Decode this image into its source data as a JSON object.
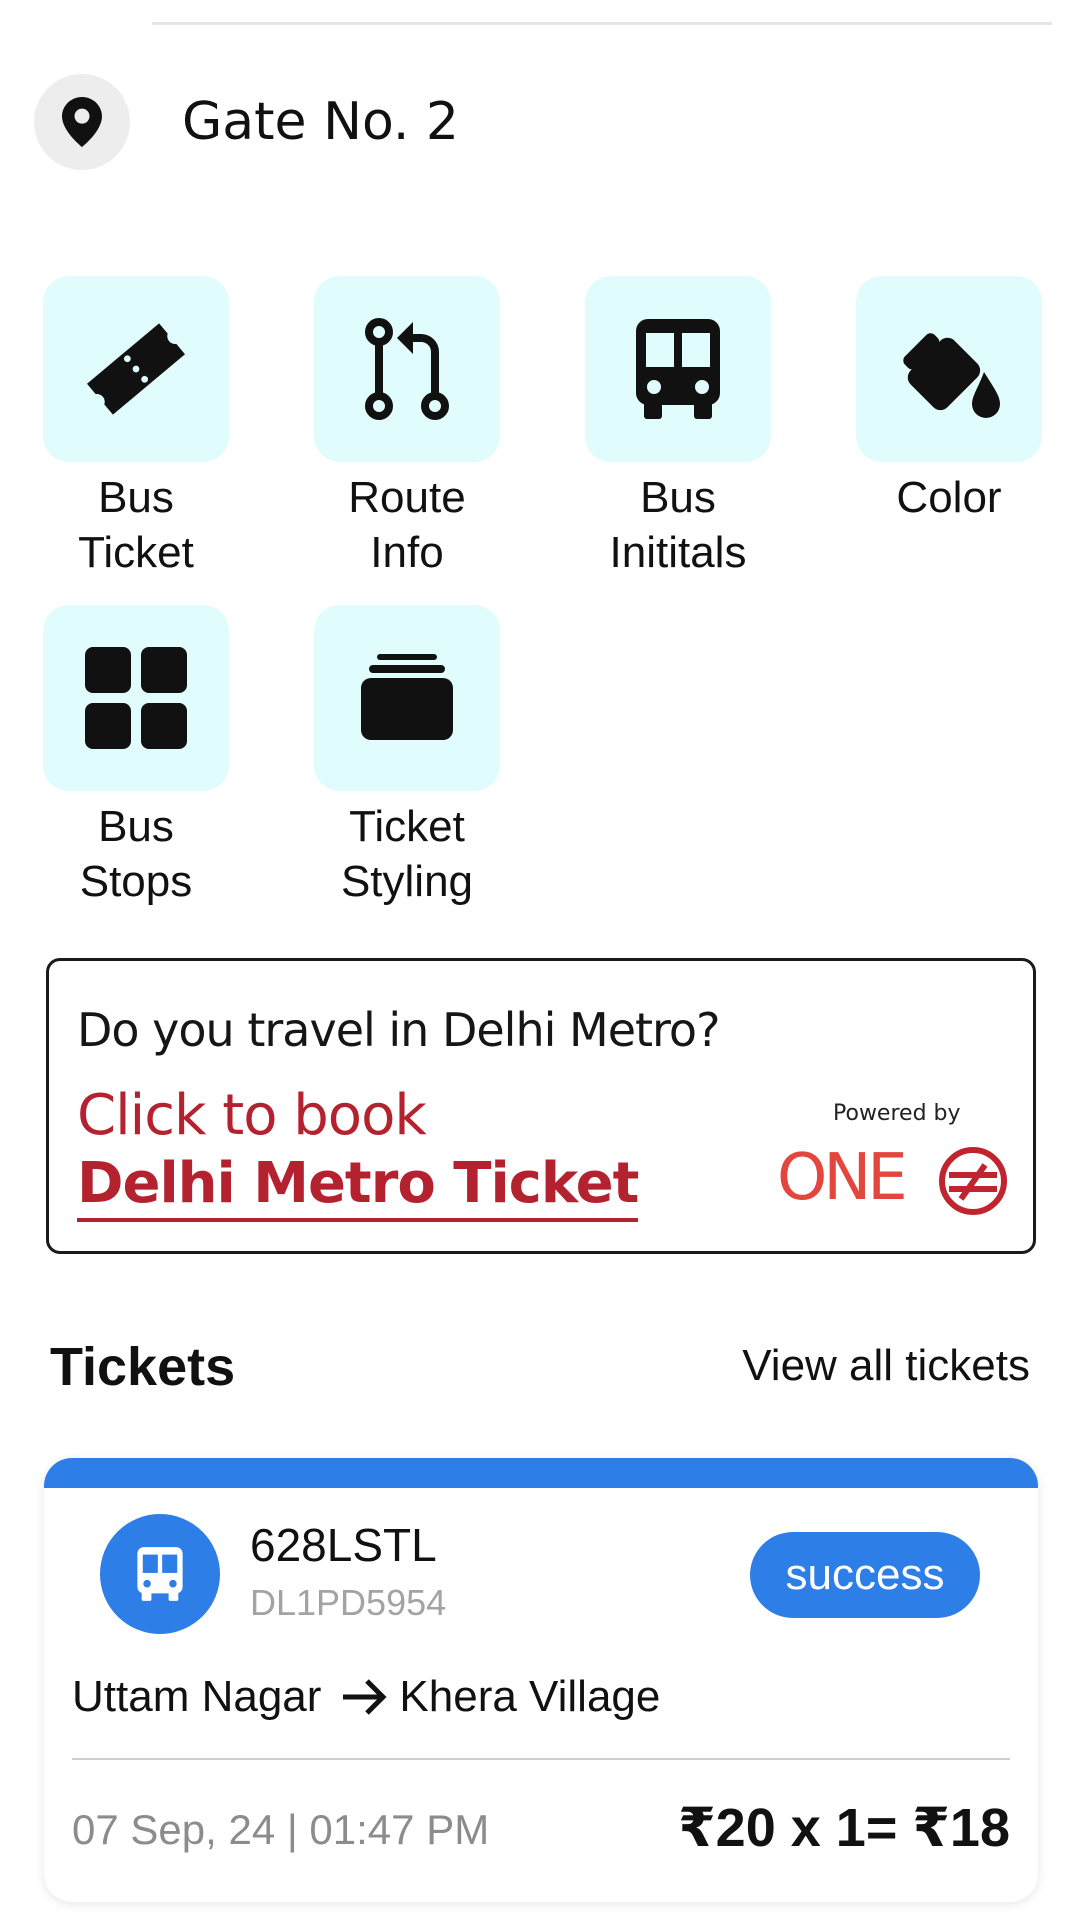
{
  "location": {
    "name": "Gate No. 2",
    "icon": "map-pin-icon"
  },
  "menu": {
    "tiles": [
      {
        "label": "Bus\nTicket",
        "icon": "ticket-icon"
      },
      {
        "label": "Route\nInfo",
        "icon": "route-icon"
      },
      {
        "label": "Bus\nInititals",
        "icon": "bus-icon"
      },
      {
        "label": "Color",
        "icon": "paint-bucket-icon"
      },
      {
        "label": "Bus\nStops",
        "icon": "grid-icon"
      },
      {
        "label": "Ticket\nStyling",
        "icon": "stack-icon"
      }
    ],
    "tile_bg": "#e0fcfc"
  },
  "metro_banner": {
    "question": "Do you travel in Delhi Metro?",
    "cta_line1": "Click to book",
    "cta_line2": "Delhi Metro Ticket",
    "powered_by": "Powered by",
    "partner_logo_text": "ONE",
    "accent": "#b5222f"
  },
  "tickets": {
    "title": "Tickets",
    "view_all": "View all tickets",
    "items": [
      {
        "route_code": "628LSTL",
        "bus_number": "DL1PD5954",
        "status": "success",
        "from": "Uttam Nagar",
        "to": "Khera Village",
        "datetime": "07 Sep, 24 | 01:47 PM",
        "fare": "₹20 x 1= ₹18"
      }
    ],
    "accent": "#2d7ee6"
  }
}
